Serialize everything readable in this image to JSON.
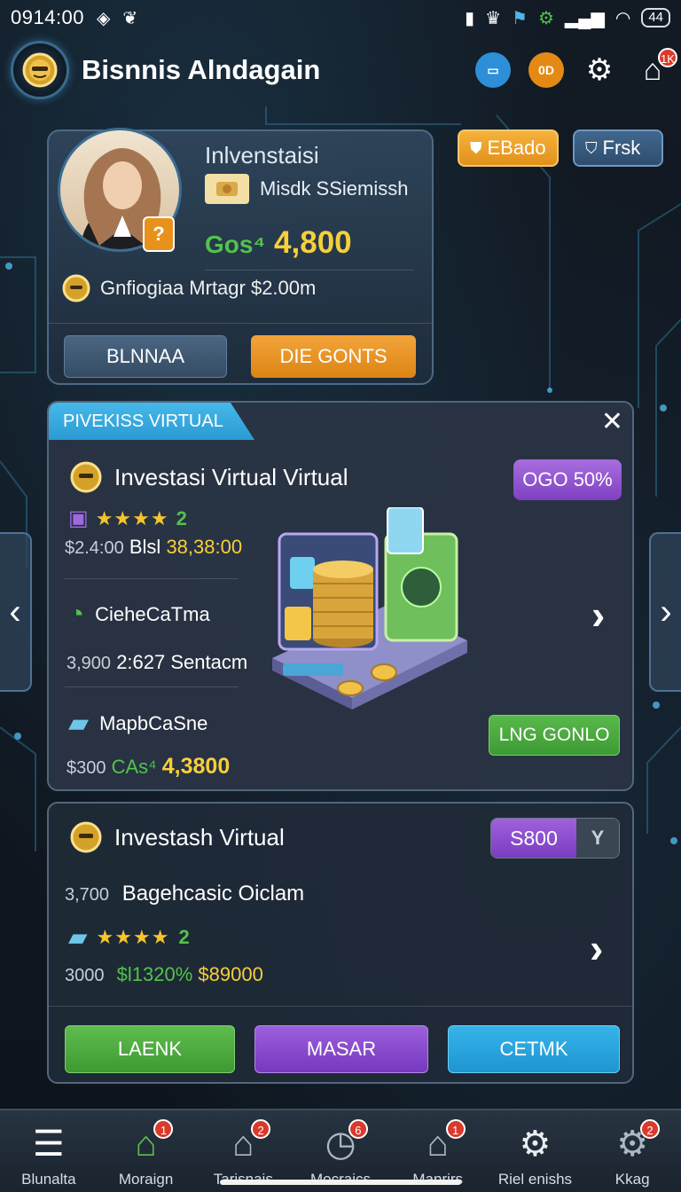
{
  "status_bar": {
    "time": "0914:00",
    "battery": "44"
  },
  "header": {
    "title": "Bisnnis Alndagain",
    "orange_badge_label": "0D",
    "notification_count": "1K"
  },
  "profile": {
    "title": "Inlvenstaisi",
    "subtitle": "Misdk SSiemissh",
    "amount_prefix": "Gos⁴",
    "amount": "4,800",
    "meta": "Gnfiogiaa Mrtagr $2.00m",
    "badge_symbol": "?",
    "buttons": {
      "left": "BLNNAA",
      "right": "DIE GONTS"
    }
  },
  "pills": {
    "orange": "EBado",
    "blue": "Frsk"
  },
  "virtual_panel": {
    "tab_label": "PIVEKISS VIRTUAL",
    "title": "Investasi Virtual Virtual",
    "percent_badge": "OGO 50%",
    "rating_stars": "★★★★",
    "rating_number": "2",
    "price_dim": "$2.4:00",
    "price_label": "Blsl",
    "price_value": "38,38:00",
    "item1": {
      "title": "CieheCaTma",
      "desc_dim": "3,900",
      "desc": "2:627 Sentacm"
    },
    "item2": {
      "title": "MapbCaSne",
      "desc_dim": "$300",
      "desc_green": "CAs⁴",
      "desc_gold": "4,3800"
    },
    "action_button": "LNG GONLO"
  },
  "card2": {
    "title": "Investash Virtual",
    "price": "S800",
    "price_toggle": "Y",
    "line_dim": "3,700",
    "line": "Bagehcasic Oiclam",
    "rating_stars": "★★★★",
    "rating_number": "2",
    "amount_dim": "3000",
    "amount_green": "$l1320%",
    "amount_gold": "$89000",
    "buttons": {
      "green": "LAENK",
      "purple": "MASAR",
      "blue": "CETMK"
    }
  },
  "bottom_nav": [
    {
      "label": "Blunalta",
      "icon": "menu-icon",
      "badge": ""
    },
    {
      "label": "Moraign",
      "icon": "home-icon",
      "badge": "1"
    },
    {
      "label": "Tarisnais",
      "icon": "home-icon",
      "badge": "2"
    },
    {
      "label": "Mocraics",
      "icon": "clock-icon",
      "badge": "6"
    },
    {
      "label": "Manrirs",
      "icon": "home-icon",
      "badge": "1"
    },
    {
      "label": "Riel enishs",
      "icon": "gear-icon",
      "badge": ""
    },
    {
      "label": "Kkag",
      "icon": "gear-icon",
      "badge": "2"
    }
  ]
}
